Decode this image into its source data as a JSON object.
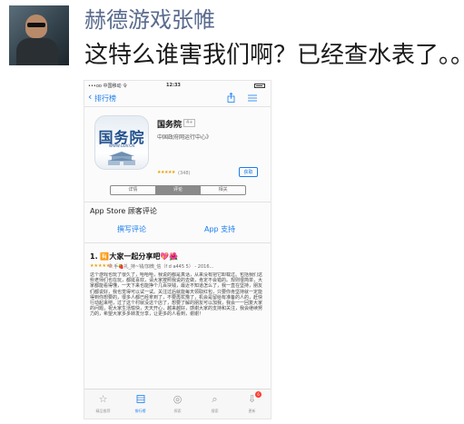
{
  "post": {
    "author": "赫德游戏张帷",
    "text": "这特么谁害我们啊？已经查水表了。。"
  },
  "screenshot": {
    "status": {
      "carrier": "•••oo 中国移动 令",
      "time": "12:33"
    },
    "nav": {
      "back_label": "排行榜"
    },
    "app": {
      "icon_title": "国务院",
      "icon_url": "WWW.GOV.CN",
      "name": "国务院",
      "age": "4+",
      "developer": "中国政府网运行中心》",
      "stars": "★★★★★",
      "rating_count": "(348)",
      "get_label": "获取"
    },
    "tabs": [
      "详情",
      "评论",
      "相关"
    ],
    "reviews": {
      "section_title": "App Store 顾客评论",
      "write_review": "撰写评论",
      "app_support": "App 支持",
      "first": {
        "title": "1. 🈶大家一起分享吧💖🌺",
        "stars": "★★★★★",
        "meta": "🍭手🍓礼_持~钱/加微_信（f d a445 5） - 2016...",
        "body": "这个游戏也玩了很久了，哈哈哈，我说的都是真话，从来没有把它卸载过。包括我们这些老师们也在玩，都挺喜欢，请大家按照我说的去做，肯定不会错的。规则很简单，大家都能看得懂，一天下来也能挣个几百块钱，最近不知道怎么了，我一直在坚持，朋友们都说好，我也觉得可以试一试。关注过后就能每天领取红包，只要你肯坚持就一定能得到你想要的，很多人都已经拿到了，不要再犹豫了，机会是留给有准备的人的，赶快行动起来吧，过了这个村就没这个店了，想要了解的朋友可以加我，我会一一回复大家的问题，祝大家生活愉快，天天开心，越来越好，感谢大家的支持和关注，我会继续努力的，希望大家多多转发分享，让更多的人看到，谢谢！"
      }
    },
    "tabbar": [
      {
        "label": "精品推荐",
        "icon": "star-icon"
      },
      {
        "label": "排行榜",
        "icon": "grid-icon"
      },
      {
        "label": "探索",
        "icon": "compass-icon"
      },
      {
        "label": "搜索",
        "icon": "search-icon"
      },
      {
        "label": "更新",
        "icon": "update-icon",
        "badge": "6"
      }
    ],
    "colors": {
      "accent": "#1a7cf0",
      "stars": "#e6a100",
      "badge": "#ff3b30"
    }
  }
}
